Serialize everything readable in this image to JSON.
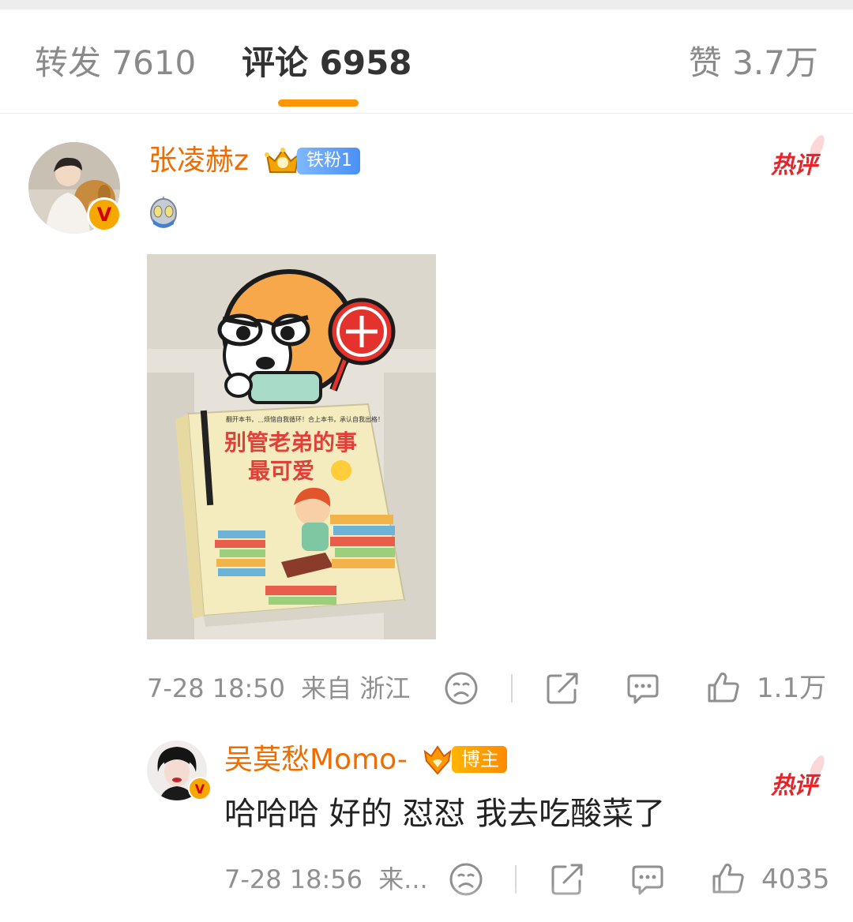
{
  "tabs": {
    "repost": "转发 7610",
    "comment": "评论 6958",
    "like": "赞 3.7万"
  },
  "comments": [
    {
      "username": "张凌赫z",
      "fan_badge": "铁粉1",
      "hot_tag": "热评",
      "emoji": "ultraman-icon",
      "image_text": {
        "top_line": "翻开本书，␣烦恼自我循环！合上本书，承认自我出格！",
        "title_line1": "别管老弟的事",
        "title_line2": "最可爱"
      },
      "time": "7-28 18:50",
      "source": "来自 浙江",
      "likes": "1.1万"
    },
    {
      "username": "吴莫愁Momo-",
      "blogger_badge": "博主",
      "hot_tag": "热评",
      "text": "哈哈哈 好的 怼怼 我去吃酸菜了",
      "time": "7-28 18:56",
      "source": "来...",
      "likes": "4035"
    }
  ],
  "colors": {
    "accent": "#ff9500",
    "username": "#f06c00",
    "hot": "#e8242b",
    "meta": "#8f8f8f"
  }
}
